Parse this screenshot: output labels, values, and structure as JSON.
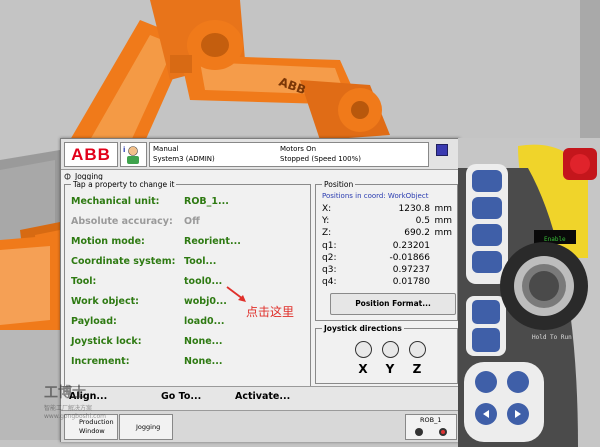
{
  "scene": {
    "robot_logo": "ABB",
    "annotation": "点击这里",
    "watermark": {
      "brand": "工博士",
      "sub": "智能工厂解决方案",
      "url": "www.gongboshi.com"
    }
  },
  "header": {
    "logo": "ABB",
    "mode": "Manual",
    "system": "System3 (ADMIN)",
    "motors": "Motors On",
    "state": "Stopped (Speed 100%)"
  },
  "app": {
    "title": "Jogging"
  },
  "properties": {
    "legend": "Tap a property to change it",
    "rows": [
      {
        "label": "Mechanical unit:",
        "value": "ROB_1...",
        "disabled": false
      },
      {
        "label": "Absolute accuracy:",
        "value": "Off",
        "disabled": true
      },
      {
        "label": "Motion mode:",
        "value": "Reorient...",
        "disabled": false
      },
      {
        "label": "Coordinate system:",
        "value": "Tool...",
        "disabled": false
      },
      {
        "label": "Tool:",
        "value": "tool0...",
        "disabled": false
      },
      {
        "label": "Work object:",
        "value": "wobj0...",
        "disabled": false
      },
      {
        "label": "Payload:",
        "value": "load0...",
        "disabled": false
      },
      {
        "label": "Joystick lock:",
        "value": "None...",
        "disabled": false
      },
      {
        "label": "Increment:",
        "value": "None...",
        "disabled": false
      }
    ]
  },
  "position": {
    "legend": "Position",
    "subtitle": "Positions in coord: WorkObject",
    "rows": [
      {
        "name": "X:",
        "value": "1230.8",
        "unit": "mm"
      },
      {
        "name": "Y:",
        "value": "0.5",
        "unit": "mm"
      },
      {
        "name": "Z:",
        "value": "690.2",
        "unit": "mm"
      },
      {
        "name": "q1:",
        "value": "0.23201",
        "unit": ""
      },
      {
        "name": "q2:",
        "value": "-0.01866",
        "unit": ""
      },
      {
        "name": "q3:",
        "value": "0.97237",
        "unit": ""
      },
      {
        "name": "q4:",
        "value": "0.01780",
        "unit": ""
      }
    ],
    "format_button": "Position Format..."
  },
  "joystick": {
    "legend": "Joystick directions",
    "axes": [
      "X",
      "Y",
      "Z"
    ]
  },
  "bottom": {
    "align": "Align...",
    "goto": "Go To...",
    "activate": "Activate..."
  },
  "taskbar": {
    "production_line1": "Production",
    "production_line2": "Window",
    "jogging": "Jogging",
    "rob": "ROB_1"
  },
  "pendant": {
    "enable_label": "Enable",
    "hold_label": "Hold To Run"
  },
  "colors": {
    "robot_orange": "#f07a1a",
    "label_green": "#2e7a12",
    "abb_red": "#e2001a",
    "pendant_blue": "#3f5fa8"
  }
}
